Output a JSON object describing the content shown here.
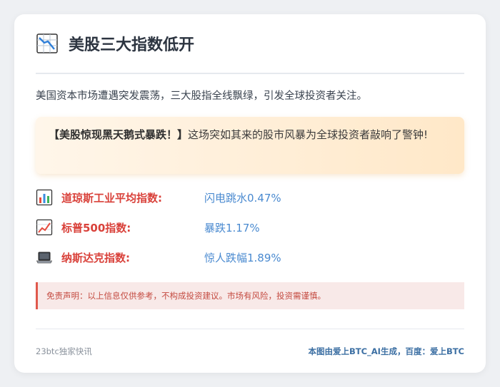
{
  "header": {
    "icon": "chart-decreasing-icon",
    "title": "美股三大指数低开"
  },
  "intro": "美国资本市场遭遇突发震荡，三大股指全线飘绿，引发全球投资者关注。",
  "alert": {
    "strong": "【美股惊现黑天鹅式暴跌！】",
    "text": "这场突如其来的股市风暴为全球投资者敲响了警钟!"
  },
  "indices": [
    {
      "icon": "bar-chart-icon",
      "label": "道琼斯工业平均指数:",
      "value": "闪电跳水0.47%"
    },
    {
      "icon": "chart-increasing-icon",
      "label": "标普500指数:",
      "value": "暴跌1.17%"
    },
    {
      "icon": "laptop-icon",
      "label": "纳斯达克指数:",
      "value": "惊人跌幅1.89%"
    }
  ],
  "disclaimer": "免责声明：以上信息仅供参考，不构成投资建议。市场有风险，投资需谨慎。",
  "footer": {
    "source": "23btc独家快讯",
    "credit": "本图由爱上BTC_AI生成，百度：爱上BTC"
  },
  "colors": {
    "title": "#2c3440",
    "index_label": "#d9413a",
    "index_value": "#4a8ad0",
    "disclaimer_text": "#c44a40",
    "footer_credit": "#3c6fa3"
  }
}
